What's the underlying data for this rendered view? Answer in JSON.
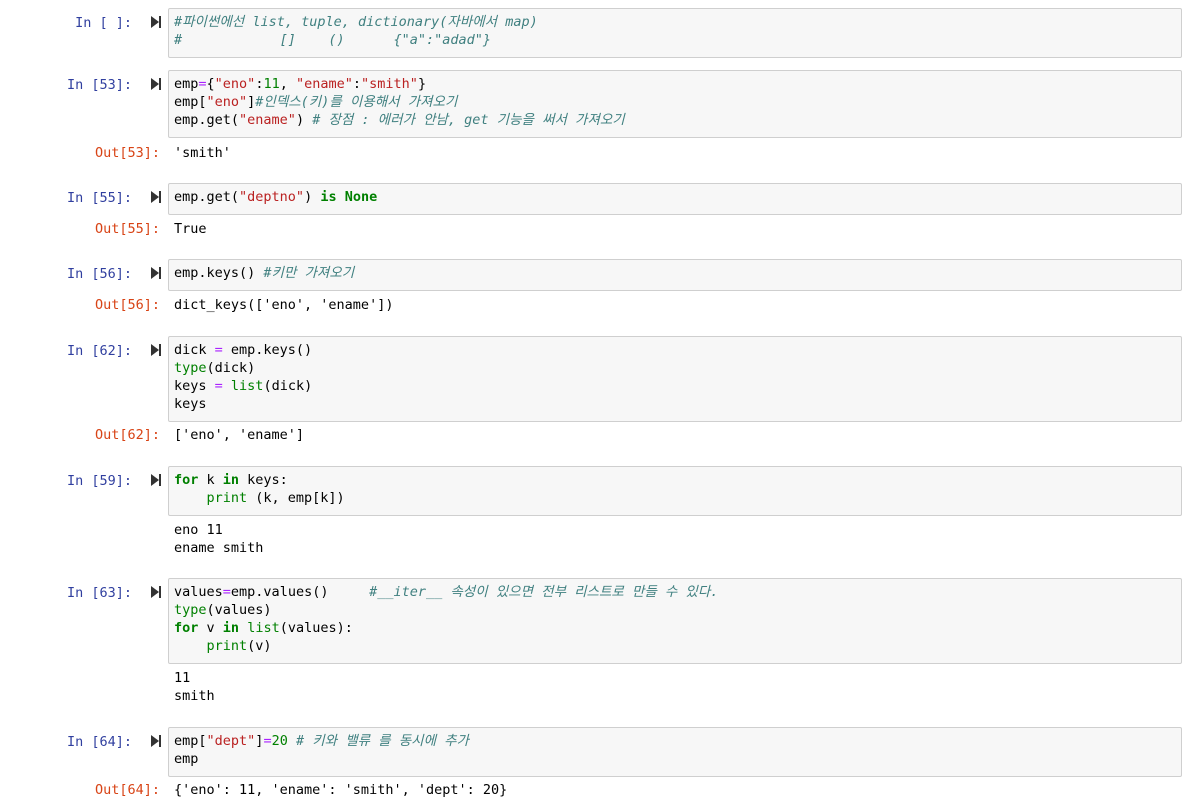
{
  "cells": [
    {
      "in_prompt": "In [ ]:",
      "lines": [
        [
          {
            "t": "#파이썬에선 list, tuple, dictionary(자바에서 map)",
            "c": "cm"
          }
        ],
        [
          {
            "t": "#            []    ()      {\"a\":\"adad\"}",
            "c": "cm"
          }
        ]
      ]
    },
    {
      "in_prompt": "In [53]:",
      "lines": [
        [
          {
            "t": "emp"
          },
          {
            "t": "=",
            "c": "op"
          },
          {
            "t": "{"
          },
          {
            "t": "\"eno\"",
            "c": "st"
          },
          {
            "t": ":"
          },
          {
            "t": "11",
            "c": "nu"
          },
          {
            "t": ", "
          },
          {
            "t": "\"ename\"",
            "c": "st"
          },
          {
            "t": ":"
          },
          {
            "t": "\"smith\"",
            "c": "st"
          },
          {
            "t": "}"
          }
        ],
        [
          {
            "t": "emp["
          },
          {
            "t": "\"eno\"",
            "c": "st"
          },
          {
            "t": "]"
          },
          {
            "t": "#인덱스(키)를 이용해서 가져오기",
            "c": "cm"
          }
        ],
        [
          {
            "t": "emp.get("
          },
          {
            "t": "\"ename\"",
            "c": "st"
          },
          {
            "t": ") "
          },
          {
            "t": "# 장점 : 에러가 안남, get 기능을 써서 가져오기",
            "c": "cm"
          }
        ]
      ],
      "out_prompt": "Out[53]:",
      "output": [
        "'smith'"
      ]
    },
    {
      "in_prompt": "In [55]:",
      "lines": [
        [
          {
            "t": "emp.get("
          },
          {
            "t": "\"deptno\"",
            "c": "st"
          },
          {
            "t": ") "
          },
          {
            "t": "is",
            "c": "kw"
          },
          {
            "t": " "
          },
          {
            "t": "None",
            "c": "kw"
          }
        ]
      ],
      "out_prompt": "Out[55]:",
      "output": [
        "True"
      ]
    },
    {
      "in_prompt": "In [56]:",
      "lines": [
        [
          {
            "t": "emp.keys() "
          },
          {
            "t": "#키만 가져오기",
            "c": "cm"
          }
        ]
      ],
      "out_prompt": "Out[56]:",
      "output": [
        "dict_keys(['eno', 'ename'])"
      ]
    },
    {
      "in_prompt": "In [62]:",
      "lines": [
        [
          {
            "t": "dick "
          },
          {
            "t": "=",
            "c": "op"
          },
          {
            "t": " emp.keys()"
          }
        ],
        [
          {
            "t": "type",
            "c": "bi"
          },
          {
            "t": "(dick)"
          }
        ],
        [
          {
            "t": "keys "
          },
          {
            "t": "=",
            "c": "op"
          },
          {
            "t": " "
          },
          {
            "t": "list",
            "c": "bi"
          },
          {
            "t": "(dick)"
          }
        ],
        [
          {
            "t": "keys"
          }
        ]
      ],
      "out_prompt": "Out[62]:",
      "output": [
        "['eno', 'ename']"
      ]
    },
    {
      "in_prompt": "In [59]:",
      "lines": [
        [
          {
            "t": "for",
            "c": "kw"
          },
          {
            "t": " k "
          },
          {
            "t": "in",
            "c": "kw"
          },
          {
            "t": " keys:"
          }
        ],
        [
          {
            "t": "    "
          },
          {
            "t": "print",
            "c": "bi"
          },
          {
            "t": " (k, emp[k])"
          }
        ]
      ],
      "out_prompt": "",
      "output": [
        "eno 11",
        "ename smith"
      ]
    },
    {
      "in_prompt": "In [63]:",
      "lines": [
        [
          {
            "t": "values"
          },
          {
            "t": "=",
            "c": "op"
          },
          {
            "t": "emp.values()     "
          },
          {
            "t": "#__iter__ 속성이 있으면 전부 리스트로 만들 수 있다.",
            "c": "cm"
          }
        ],
        [
          {
            "t": "type",
            "c": "bi"
          },
          {
            "t": "(values)"
          }
        ],
        [
          {
            "t": "for",
            "c": "kw"
          },
          {
            "t": " v "
          },
          {
            "t": "in",
            "c": "kw"
          },
          {
            "t": " "
          },
          {
            "t": "list",
            "c": "bi"
          },
          {
            "t": "(values):"
          }
        ],
        [
          {
            "t": "    "
          },
          {
            "t": "print",
            "c": "bi"
          },
          {
            "t": "(v)"
          }
        ]
      ],
      "out_prompt": "",
      "output": [
        "11",
        "smith"
      ]
    },
    {
      "in_prompt": "In [64]:",
      "lines": [
        [
          {
            "t": "emp["
          },
          {
            "t": "\"dept\"",
            "c": "st"
          },
          {
            "t": "]"
          },
          {
            "t": "=",
            "c": "op"
          },
          {
            "t": "20",
            "c": "nu"
          },
          {
            "t": " "
          },
          {
            "t": "# 키와 밸류 를 동시에 추가",
            "c": "cm"
          }
        ],
        [
          {
            "t": "emp"
          }
        ]
      ],
      "out_prompt": "Out[64]:",
      "output": [
        "{'eno': 11, 'ename': 'smith', 'dept': 20}"
      ]
    }
  ],
  "colors": {
    "in_prompt": "#303f9f",
    "out_prompt": "#d84315",
    "comment": "#408080",
    "string": "#ba2121",
    "keyword": "#008000",
    "operator": "#aa22ff",
    "input_bg": "#f7f7f7",
    "input_border": "#cfcfcf"
  },
  "icons": {
    "run_button": "run-cell-icon"
  }
}
